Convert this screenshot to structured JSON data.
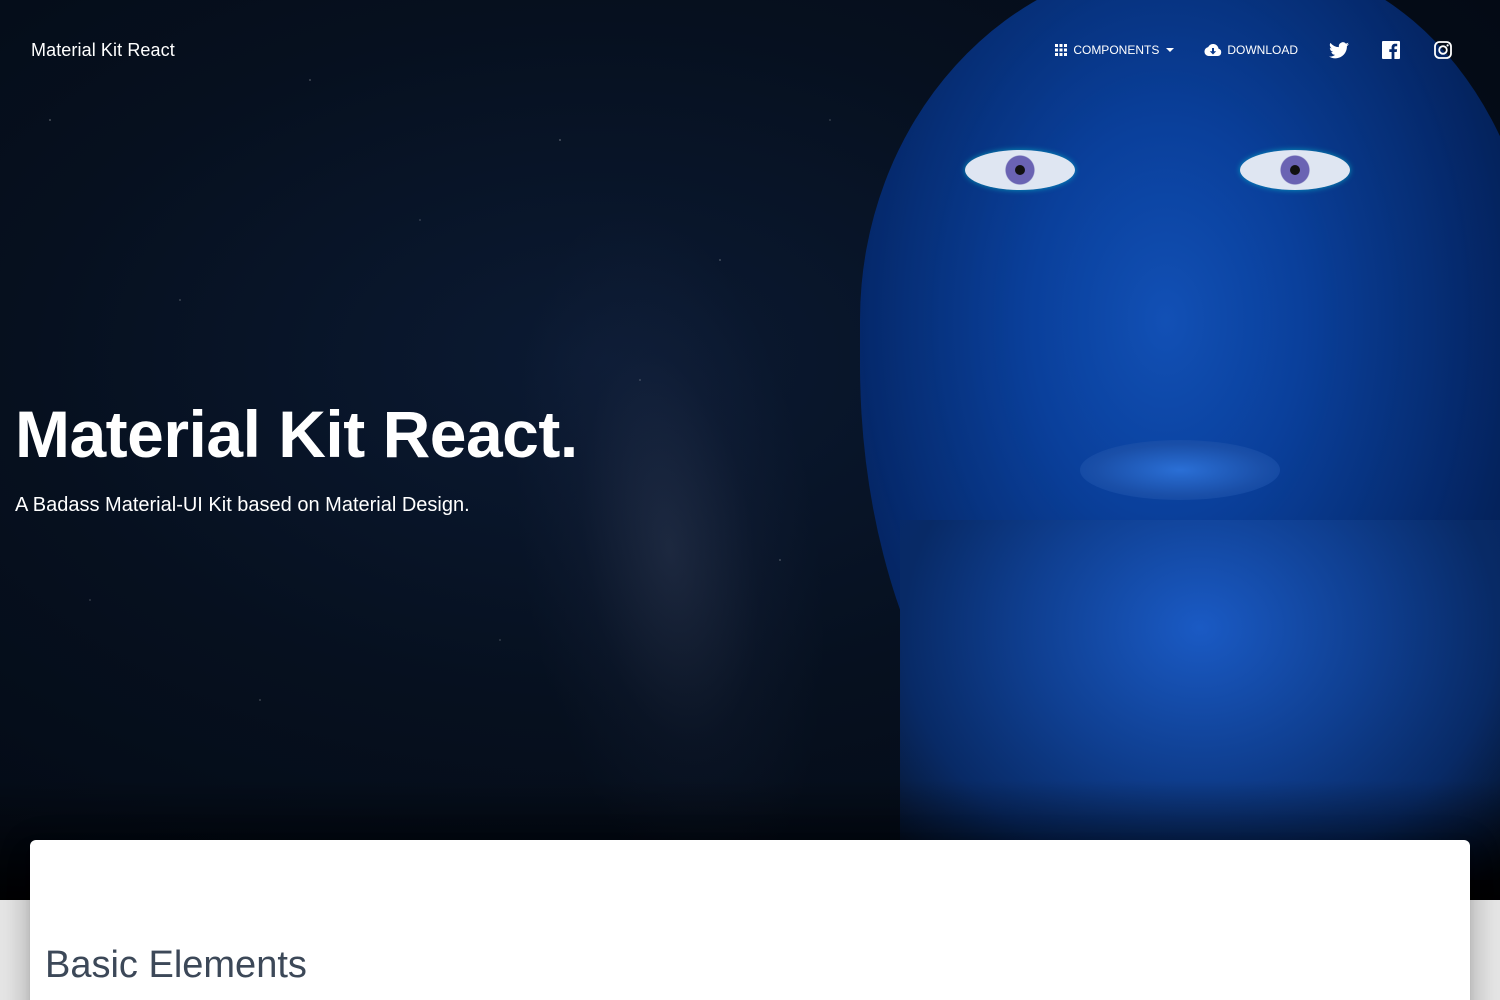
{
  "navbar": {
    "brand": "Material Kit React",
    "components_label": "Components",
    "download_label": "Download",
    "social": [
      "twitter-icon",
      "facebook-icon",
      "instagram-icon"
    ]
  },
  "hero": {
    "title": "Material Kit React.",
    "subtitle": "A Badass Material-UI Kit based on Material Design."
  },
  "main": {
    "section_title": "Basic Elements"
  },
  "colors": {
    "hero_bg": "#06101f",
    "accent_blue": "#1b4fa3",
    "title_text": "#3c4858"
  }
}
